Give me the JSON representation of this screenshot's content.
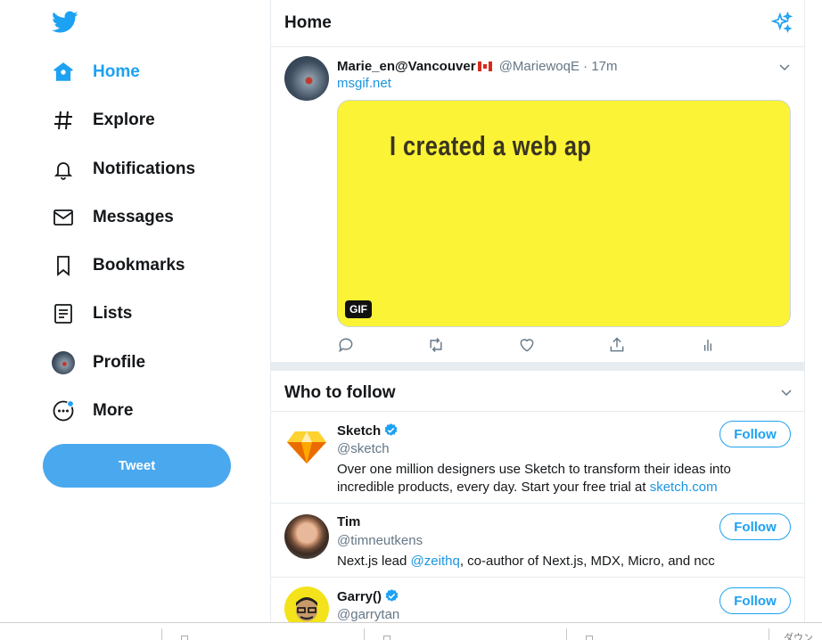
{
  "sidebar": {
    "logo": "twitter-bird-icon",
    "items": [
      {
        "label": "Home",
        "icon": "home-icon",
        "active": true
      },
      {
        "label": "Explore",
        "icon": "hashtag-icon"
      },
      {
        "label": "Notifications",
        "icon": "bell-icon"
      },
      {
        "label": "Messages",
        "icon": "envelope-icon"
      },
      {
        "label": "Bookmarks",
        "icon": "bookmark-icon"
      },
      {
        "label": "Lists",
        "icon": "list-icon"
      },
      {
        "label": "Profile",
        "icon": "avatar"
      },
      {
        "label": "More",
        "icon": "more-icon"
      }
    ],
    "tweet_button": "Tweet"
  },
  "header": {
    "title": "Home",
    "icon": "sparkle-icon"
  },
  "tweet": {
    "name": "Marie_en@Vancouver",
    "handle": "@MariewoqE",
    "time": "17m",
    "separator": "·",
    "link": "msgif.net",
    "gif_text": "I created a web ap",
    "gif_badge": "GIF",
    "actions": [
      "reply-icon",
      "retweet-icon",
      "like-icon",
      "share-icon",
      "analytics-icon"
    ]
  },
  "who_to_follow": {
    "title": "Who to follow",
    "accounts": [
      {
        "name": "Sketch",
        "handle": "@sketch",
        "verified": true,
        "bio": "Over one million designers use Sketch to transform their ideas into incredible products, every day. Start your free trial at ",
        "bio_link": "sketch.com",
        "button": "Follow"
      },
      {
        "name": "Tim",
        "handle": "@timneutkens",
        "verified": false,
        "bio_prefix": "Next.js lead ",
        "bio_link": "@zeithq",
        "bio_suffix": ", co-author of Next.js, MDX, Micro, and ncc",
        "button": "Follow"
      },
      {
        "name": "Garry()",
        "handle": "@garrytan",
        "verified": true,
        "button": "Follow"
      }
    ]
  },
  "bottom_bar": {
    "text": "ダウン"
  },
  "colors": {
    "accent": "#1da1f2",
    "gif_bg": "#fbf335",
    "text": "#14171a",
    "muted": "#657786"
  }
}
